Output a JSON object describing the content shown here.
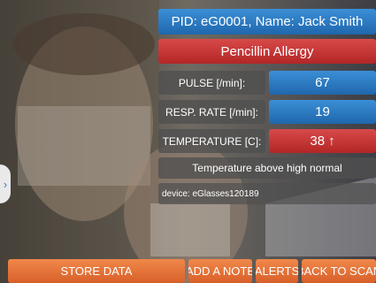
{
  "patient": {
    "header": "PID: eG0001,  Name: Jack Smith",
    "allergy": "Pencillin Allergy"
  },
  "vitals": [
    {
      "label": "PULSE [/min]:",
      "value": "67",
      "status": "normal"
    },
    {
      "label": "RESP. RATE [/min]:",
      "value": "19",
      "status": "normal"
    },
    {
      "label": "TEMPERATURE [C]:",
      "value": "38",
      "trend": "↑",
      "status": "high"
    }
  ],
  "alert_text": "Temperature above high normal",
  "device_text": "device: eGlasses120189",
  "buttons": {
    "store": "STORE DATA",
    "note": "ADD A NOTE",
    "alerts": "ALERTS",
    "back": "BACK TO SCAN"
  },
  "colors": {
    "blue": "#2a7cc7",
    "red": "#c83232",
    "orange": "#e8743a"
  }
}
